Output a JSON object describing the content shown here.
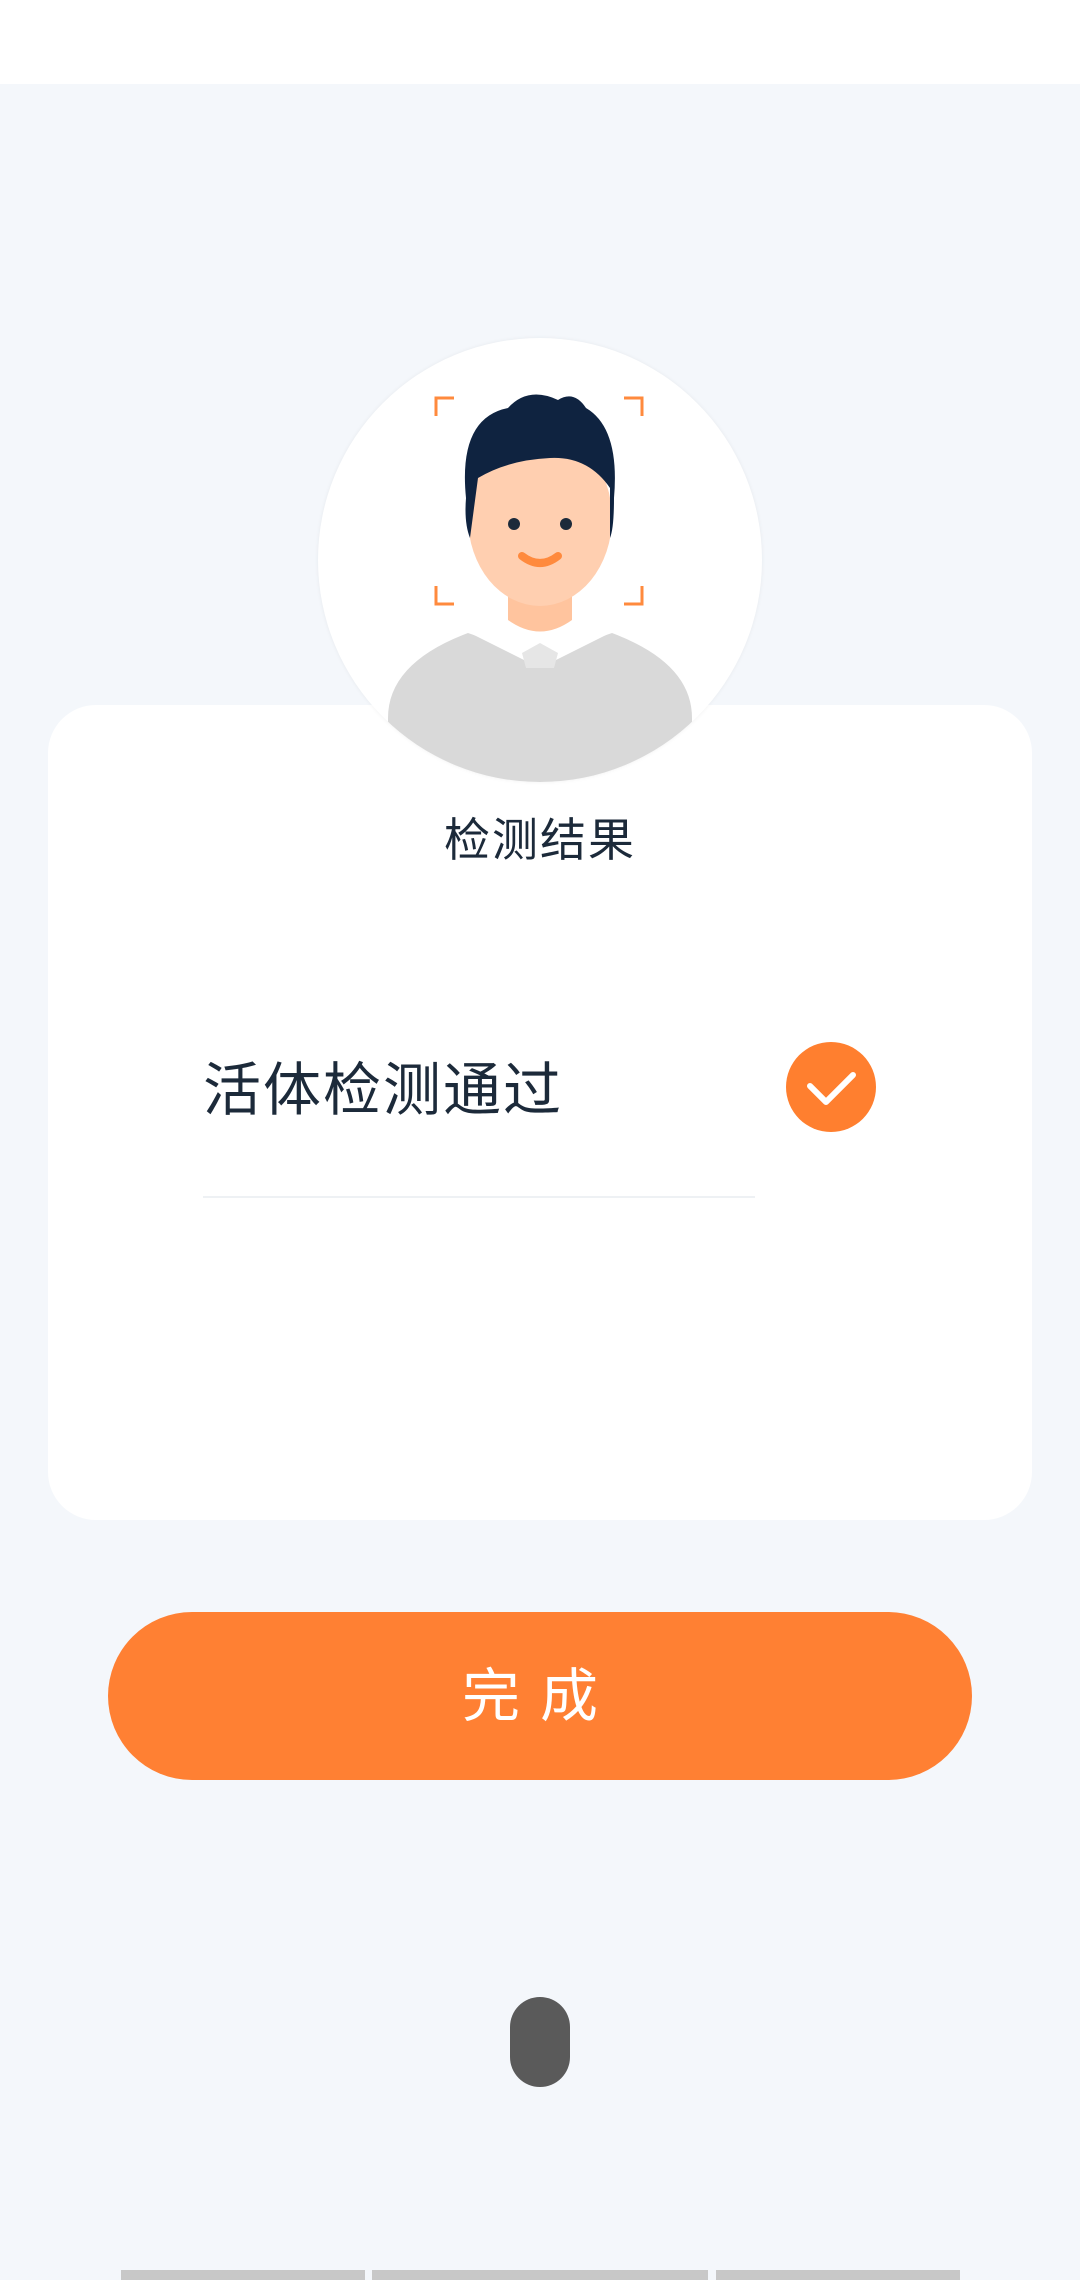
{
  "status_bar": {},
  "avatar": {
    "icon": "face-scan-avatar-icon",
    "colors": {
      "frame_corners": "#ff8a3d",
      "hair": "#0f2340",
      "skin": "#ffcfb0",
      "shirt": "#d9d9d9",
      "smile": "#ff8a3d"
    }
  },
  "result": {
    "title": "检测结果",
    "status_text": "活体检测通过",
    "status_icon": "check-circle-icon"
  },
  "actions": {
    "done_label": "完成"
  },
  "colors": {
    "accent": "#ff8033",
    "page_background": "#f4f7fb",
    "card_background": "#ffffff",
    "text_primary": "#1c2a3a"
  }
}
